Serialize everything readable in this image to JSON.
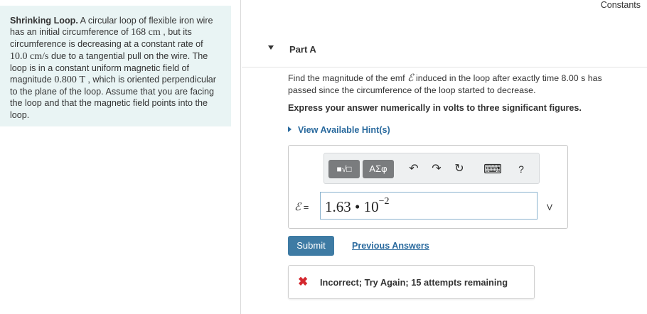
{
  "problem": {
    "title": "Shrinking Loop.",
    "t1": " A circular loop of flexible iron wire has an initial circumference of ",
    "circumference": "168",
    "circumference_unit": "cm",
    "t2": " , but its circumference is decreasing at a constant rate of ",
    "rate": "10.0",
    "rate_unit": "cm/s",
    "t3": " due to a tangential pull on the wire. The loop is in a constant uniform magnetic field of magnitude ",
    "field": "0.800",
    "field_unit": "T",
    "t4": " , which is oriented perpendicular to the plane of the loop. Assume that you are facing the loop and that the magnetic field points into the loop."
  },
  "header": {
    "constants": "Constants"
  },
  "part": {
    "label": "Part A"
  },
  "question": {
    "pre": "Find the magnitude of the emf ",
    "emf_symbol": "ℰ",
    "post": " induced in the loop after exactly time 8.00 s has passed since the circumference of the loop started to decrease.",
    "instruction": "Express your answer numerically in volts to three significant figures.",
    "hint_link": "View Available Hint(s)"
  },
  "toolbar": {
    "templates_icon": "■√□",
    "symbols_label": "ΑΣφ",
    "undo_icon": "↶",
    "redo_icon": "↷",
    "reset_icon": "↻",
    "keyboard_icon": "⌨",
    "help_label": "?"
  },
  "answer": {
    "lhs_symbol": "ℰ",
    "lhs_eq": " =",
    "value_mantissa": "1.63 • 10",
    "value_exponent": "−2",
    "unit": "V"
  },
  "actions": {
    "submit": "Submit",
    "previous_answers": "Previous Answers"
  },
  "feedback": {
    "icon": "✖",
    "message": "Incorrect; Try Again; 15 attempts remaining"
  },
  "colors": {
    "problem_bg": "#e9f4f4",
    "accent": "#3e7ba4",
    "link": "#2a6a9e",
    "error": "#d4282f"
  }
}
